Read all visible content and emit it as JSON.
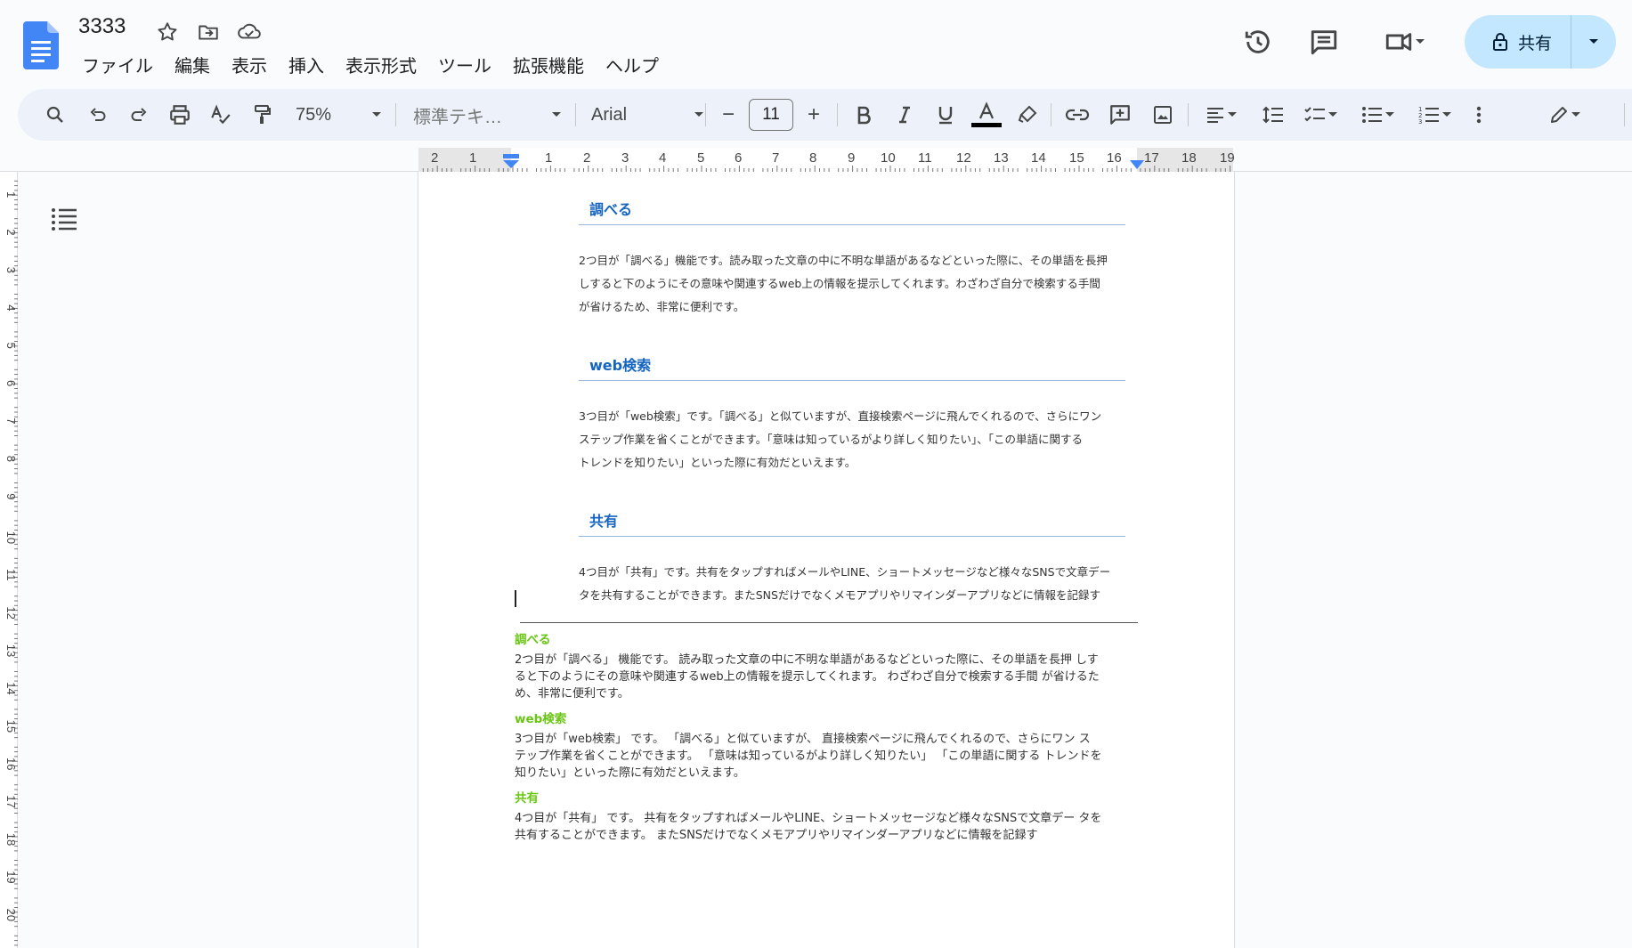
{
  "doc": {
    "title": "3333"
  },
  "menu": [
    "ファイル",
    "編集",
    "表示",
    "挿入",
    "表示形式",
    "ツール",
    "拡張機能",
    "ヘルプ"
  ],
  "share": {
    "label": "共有"
  },
  "toolbar": {
    "zoom": "75%",
    "style": "標準テキ…",
    "font": "Arial",
    "font_size": "11",
    "minus": "−",
    "plus": "+"
  },
  "ruler": {
    "numbers": [
      "2",
      "1",
      "1",
      "2",
      "3",
      "4",
      "5",
      "6",
      "7",
      "8",
      "9",
      "10",
      "11",
      "12",
      "13",
      "14",
      "15",
      "16",
      "17",
      "18",
      "19"
    ],
    "vnumbers": [
      "1",
      "2",
      "3",
      "4",
      "5",
      "6",
      "7",
      "8",
      "9",
      "10",
      "11",
      "12",
      "13",
      "14",
      "15",
      "16",
      "17",
      "18",
      "19",
      "20"
    ]
  },
  "content": {
    "sections": [
      {
        "heading": "調べる",
        "text_lines": [
          "2つ目が「調べる」機能です。読み取った文章の中に不明な単語があるなどといった際に、その単語を長押",
          "しすると下のようにその意味や関連するweb上の情報を提示してくれます。わざわざ自分で検索する手間",
          "が省けるため、非常に便利です。"
        ]
      },
      {
        "heading": "web検索",
        "text_lines": [
          "3つ目が「web検索」です。「調べる」と似ていますが、直接検索ページに飛んでくれるので、さらにワン",
          "ステップ作業を省くことができます。「意味は知っているがより詳しく知りたい」、「この単語に関する",
          "トレンドを知りたい」といった際に有効だといえます。"
        ]
      },
      {
        "heading": "共有",
        "text_lines": [
          "4つ目が「共有」です。共有をタップすればメールやLINE、ショートメッセージなど様々なSNSで文章デー",
          "タを共有することができます。またSNSだけでなくメモアプリやリマインダーアプリなどに情報を記録す"
        ]
      }
    ],
    "pasted": [
      {
        "heading": "調べる",
        "text_lines": [
          "2つ目が「調べる」 機能です。 読み取った文章の中に不明な単語があるなどといった際に、その単語を長押 しす",
          "ると下のようにその意味や関連するweb上の情報を提示してくれます。 わざわざ自分で検索する手間 が省けるた",
          "め、非常に便利です。"
        ]
      },
      {
        "heading": "web検索",
        "text_lines": [
          "3つ目が「web検索」 です。 「調べる」と似ていますが、 直接検索ページに飛んでくれるので、さらにワン ス",
          "テップ作業を省くことができます。 「意味は知っているがより詳しく知りたい」 「この単語に関する トレンドを",
          "知りたい」といった際に有効だといえます。"
        ]
      },
      {
        "heading": "共有",
        "text_lines": [
          "4つ目が「共有」 です。 共有をタップすればメールやLINE、ショートメッセージなど様々なSNSで文章デー タを",
          "共有することができます。 またSNSだけでなくメモアプリやリマインダーアプリなどに情報を記録す"
        ]
      }
    ]
  },
  "colors": {
    "heading_blue": "#1565c0",
    "heading_green": "#6ac614",
    "share_bg": "#c2e7ff",
    "toolbar_bg": "#edf2fa",
    "docs_blue": "#4285f4"
  },
  "icons": {
    "title": [
      "star-icon",
      "move-to-folder-icon",
      "cloud-saved-icon"
    ],
    "right": [
      "version-history-icon",
      "comments-icon",
      "meet-icon"
    ]
  }
}
